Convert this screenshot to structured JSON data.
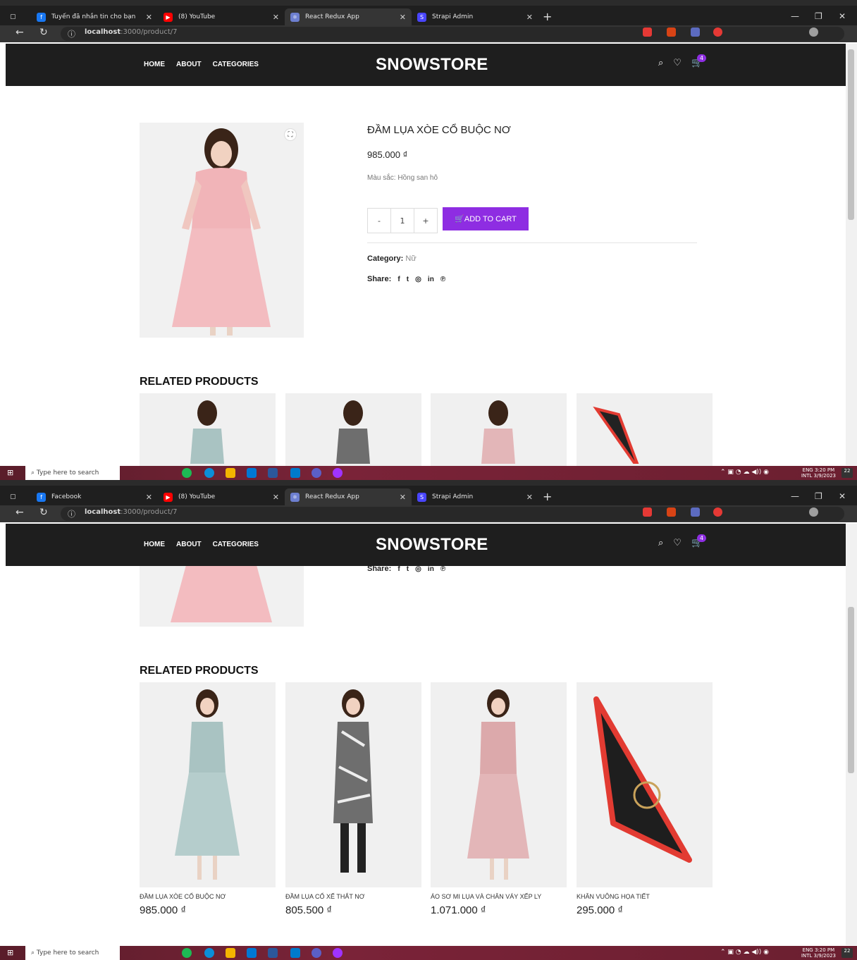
{
  "browser": {
    "shot1_tabs": [
      {
        "title": "Tuyến đã nhắn tin cho bạn",
        "fav_color": "#1877f2"
      },
      {
        "title": "(8) YouTube",
        "fav_color": "#ff0000"
      },
      {
        "title": "React Redux App",
        "fav_color": "#6d7fd1"
      },
      {
        "title": "Strapi Admin",
        "fav_color": "#4945ff"
      }
    ],
    "shot2_tabs": [
      {
        "title": "Facebook",
        "fav_color": "#1877f2"
      },
      {
        "title": "(8) YouTube",
        "fav_color": "#ff0000"
      },
      {
        "title": "React Redux App",
        "fav_color": "#6d7fd1"
      },
      {
        "title": "Strapi Admin",
        "fav_color": "#4945ff"
      }
    ],
    "url_host": "localhost",
    "url_path": ":3000/product/7"
  },
  "header": {
    "menu": [
      "HOME",
      "ABOUT",
      "CATEGORIES"
    ],
    "logo": "SNOWSTORE",
    "cart_count": "4"
  },
  "product": {
    "title": "ĐẦM LỤA XÒE CỔ BUỘC NƠ",
    "price": "985.000 ₫",
    "color": "Màu sắc: Hồng san hô",
    "qty_minus": "-",
    "qty_value": "1",
    "qty_plus": "+",
    "add_to_cart": "ADD TO CART",
    "category_label": "Category:",
    "category_value": "Nữ",
    "share_label": "Share:",
    "share_icons": [
      "f",
      "t",
      "◎",
      "in",
      "℗"
    ]
  },
  "related": {
    "heading": "RELATED PRODUCTS",
    "items": [
      {
        "name": "ĐẦM LỤA XÒE CỔ BUỘC NƠ",
        "price": "985.000 ₫",
        "dress_color": "#a9c3c2"
      },
      {
        "name": "ĐẦM LỤA CỔ XẾ THẮT NƠ",
        "price": "805.500 ₫",
        "dress_color": "#6e6e6e"
      },
      {
        "name": "ÁO SƠ MI LỤA VÀ CHÂN VÁY XẾP LY",
        "price": "1.071.000 ₫",
        "dress_color": "#e3b6b8"
      },
      {
        "name": "KHĂN VUÔNG HỌA TIẾT",
        "price": "295.000 ₫",
        "dress_color": "#222222"
      }
    ]
  },
  "taskbar": {
    "search_placeholder": "Type here to search",
    "lang": "ENG",
    "lang2": "INTL",
    "time": "3:20 PM",
    "date": "3/9/2023",
    "notif": "22"
  },
  "colors": {
    "accent": "#8e2de2",
    "header_bg": "#1e1e1e",
    "dress_pink": "#f1b4b8"
  }
}
